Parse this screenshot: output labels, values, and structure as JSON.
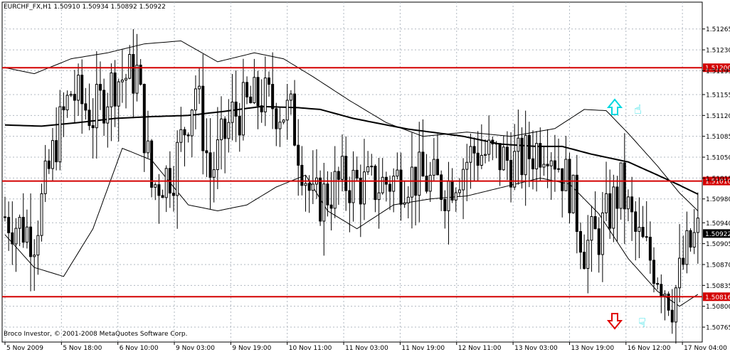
{
  "header": {
    "symbol": "EURCHF_FX,H1",
    "ohlc": "1.50910 1.50934 1.50892 1.50922"
  },
  "copyright": "Broco Investor, © 2001-2008 MetaQuotes Software Corp.",
  "colors": {
    "candle": "#000000",
    "level_line": "#d40000",
    "level_tag_bg": "#d40000",
    "current_tag_bg": "#000000",
    "up_arrow": "#00d8e0",
    "down_arrow": "#e00000",
    "grid": "#b0b8c0"
  },
  "icons": [
    "up-arrow-icon",
    "hand-up-icon",
    "down-arrow-icon",
    "hand-down-icon"
  ],
  "chart_data": {
    "type": "candlestick",
    "symbol": "EURCHF_FX",
    "timeframe": "H1",
    "ylim": [
      1.5074,
      1.5131
    ],
    "y_ticks": [
      "1.51265",
      "1.51230",
      "1.51195",
      "1.51155",
      "1.51120",
      "1.51085",
      "1.51050",
      "1.51015",
      "1.50980",
      "1.50940",
      "1.50905",
      "1.50870",
      "1.50835",
      "1.50800",
      "1.50765"
    ],
    "x_ticks": [
      "5 Nov 2009",
      "5 Nov 18:00",
      "6 Nov 10:00",
      "9 Nov 03:00",
      "9 Nov 19:00",
      "10 Nov 11:00",
      "11 Nov 03:00",
      "11 Nov 19:00",
      "12 Nov 11:00",
      "13 Nov 03:00",
      "13 Nov 19:00",
      "16 Nov 12:00",
      "17 Nov 04:00"
    ],
    "bars_count": 190,
    "horizontal_levels": [
      {
        "value": 1.512,
        "label": "1.51200"
      },
      {
        "value": 1.5101,
        "label": "1.51010"
      },
      {
        "value": 1.50816,
        "label": "1.50816"
      }
    ],
    "current_price": {
      "value": 1.50922,
      "label": "1.50922"
    },
    "price_path": [
      {
        "bar": 0,
        "price": 1.5095
      },
      {
        "bar": 8,
        "price": 1.5092
      },
      {
        "bar": 14,
        "price": 1.5108
      },
      {
        "bar": 18,
        "price": 1.5116
      },
      {
        "bar": 24,
        "price": 1.5112
      },
      {
        "bar": 30,
        "price": 1.5118
      },
      {
        "bar": 36,
        "price": 1.5119
      },
      {
        "bar": 40,
        "price": 1.51
      },
      {
        "bar": 46,
        "price": 1.5103
      },
      {
        "bar": 52,
        "price": 1.5117
      },
      {
        "bar": 56,
        "price": 1.5102
      },
      {
        "bar": 62,
        "price": 1.5112
      },
      {
        "bar": 70,
        "price": 1.5115
      },
      {
        "bar": 78,
        "price": 1.5112
      },
      {
        "bar": 84,
        "price": 1.5097
      },
      {
        "bar": 92,
        "price": 1.5101
      },
      {
        "bar": 100,
        "price": 1.51
      },
      {
        "bar": 110,
        "price": 1.5102
      },
      {
        "bar": 120,
        "price": 1.51
      },
      {
        "bar": 128,
        "price": 1.5106
      },
      {
        "bar": 140,
        "price": 1.5104
      },
      {
        "bar": 148,
        "price": 1.5108
      },
      {
        "bar": 154,
        "price": 1.51
      },
      {
        "bar": 158,
        "price": 1.509
      },
      {
        "bar": 162,
        "price": 1.5092
      },
      {
        "bar": 168,
        "price": 1.51
      },
      {
        "bar": 172,
        "price": 1.5092
      },
      {
        "bar": 178,
        "price": 1.5086
      },
      {
        "bar": 182,
        "price": 1.5081
      },
      {
        "bar": 186,
        "price": 1.5089
      },
      {
        "bar": 189,
        "price": 1.50922
      }
    ],
    "moving_average": [
      {
        "bar": 0,
        "price": 1.51104
      },
      {
        "bar": 10,
        "price": 1.51102
      },
      {
        "bar": 20,
        "price": 1.51108
      },
      {
        "bar": 30,
        "price": 1.51115
      },
      {
        "bar": 40,
        "price": 1.51118
      },
      {
        "bar": 50,
        "price": 1.5112
      },
      {
        "bar": 60,
        "price": 1.51127
      },
      {
        "bar": 70,
        "price": 1.51135
      },
      {
        "bar": 80,
        "price": 1.51133
      },
      {
        "bar": 86,
        "price": 1.5113
      },
      {
        "bar": 95,
        "price": 1.51115
      },
      {
        "bar": 110,
        "price": 1.51097
      },
      {
        "bar": 125,
        "price": 1.51085
      },
      {
        "bar": 135,
        "price": 1.51072
      },
      {
        "bar": 145,
        "price": 1.51068
      },
      {
        "bar": 152,
        "price": 1.51068
      },
      {
        "bar": 160,
        "price": 1.51055
      },
      {
        "bar": 170,
        "price": 1.51042
      },
      {
        "bar": 178,
        "price": 1.5102
      },
      {
        "bar": 184,
        "price": 1.51003
      },
      {
        "bar": 189,
        "price": 1.50988
      }
    ],
    "bollinger_upper": [
      {
        "bar": 0,
        "price": 1.512
      },
      {
        "bar": 8,
        "price": 1.5119
      },
      {
        "bar": 18,
        "price": 1.51215
      },
      {
        "bar": 28,
        "price": 1.51225
      },
      {
        "bar": 38,
        "price": 1.5124
      },
      {
        "bar": 48,
        "price": 1.51245
      },
      {
        "bar": 58,
        "price": 1.5121
      },
      {
        "bar": 68,
        "price": 1.51225
      },
      {
        "bar": 76,
        "price": 1.51215
      },
      {
        "bar": 84,
        "price": 1.51185
      },
      {
        "bar": 94,
        "price": 1.51145
      },
      {
        "bar": 104,
        "price": 1.51108
      },
      {
        "bar": 114,
        "price": 1.51085
      },
      {
        "bar": 126,
        "price": 1.51092
      },
      {
        "bar": 138,
        "price": 1.51085
      },
      {
        "bar": 150,
        "price": 1.51098
      },
      {
        "bar": 158,
        "price": 1.5113
      },
      {
        "bar": 164,
        "price": 1.51128
      },
      {
        "bar": 170,
        "price": 1.5109
      },
      {
        "bar": 178,
        "price": 1.51035
      },
      {
        "bar": 184,
        "price": 1.5099
      },
      {
        "bar": 189,
        "price": 1.5096
      }
    ],
    "bollinger_lower": [
      {
        "bar": 0,
        "price": 1.5092
      },
      {
        "bar": 8,
        "price": 1.50865
      },
      {
        "bar": 16,
        "price": 1.5085
      },
      {
        "bar": 24,
        "price": 1.5093
      },
      {
        "bar": 32,
        "price": 1.51065
      },
      {
        "bar": 40,
        "price": 1.51045
      },
      {
        "bar": 50,
        "price": 1.5097
      },
      {
        "bar": 58,
        "price": 1.5096
      },
      {
        "bar": 66,
        "price": 1.5097
      },
      {
        "bar": 74,
        "price": 1.51
      },
      {
        "bar": 82,
        "price": 1.5102
      },
      {
        "bar": 88,
        "price": 1.5096
      },
      {
        "bar": 96,
        "price": 1.5093
      },
      {
        "bar": 106,
        "price": 1.5097
      },
      {
        "bar": 116,
        "price": 1.5098
      },
      {
        "bar": 126,
        "price": 1.50985
      },
      {
        "bar": 136,
        "price": 1.51
      },
      {
        "bar": 146,
        "price": 1.51015
      },
      {
        "bar": 154,
        "price": 1.51005
      },
      {
        "bar": 162,
        "price": 1.50955
      },
      {
        "bar": 170,
        "price": 1.5088
      },
      {
        "bar": 178,
        "price": 1.50825
      },
      {
        "bar": 184,
        "price": 1.508
      },
      {
        "bar": 189,
        "price": 1.5082
      }
    ]
  }
}
